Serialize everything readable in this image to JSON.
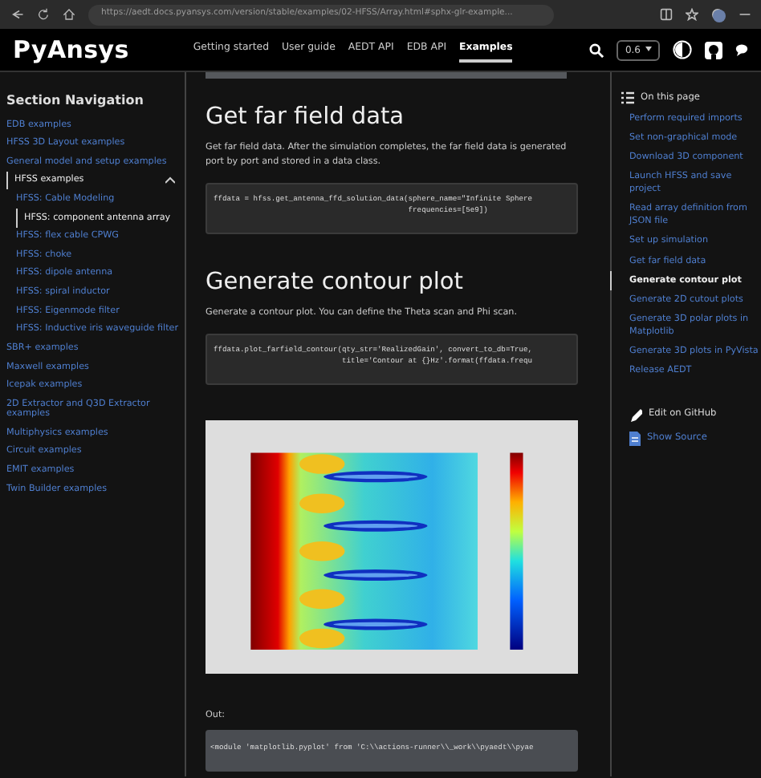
{
  "browser": {
    "url": "https://aedt.docs.pyansys.com/version/stable/examples/02-HFSS/Array.html#sphx-glr-example..."
  },
  "header": {
    "logo": "PyAnsys",
    "nav": [
      {
        "label": "Getting started",
        "selected": false
      },
      {
        "label": "User guide",
        "selected": false
      },
      {
        "label": "AEDT API",
        "selected": false
      },
      {
        "label": "EDB API",
        "selected": false
      },
      {
        "label": "Examples",
        "selected": true
      }
    ],
    "version": "0.6"
  },
  "sidebar": {
    "title": "Section Navigation",
    "items": [
      {
        "label": "EDB examples",
        "selected": false
      },
      {
        "label": "HFSS 3D Layout examples",
        "selected": false
      },
      {
        "label": "General model and setup examples",
        "selected": false
      },
      {
        "label": "HFSS examples",
        "selected": true,
        "expanded": true,
        "children": [
          {
            "label": "HFSS: Cable Modeling",
            "selected": false
          },
          {
            "label": "HFSS: component antenna array",
            "selected": true
          },
          {
            "label": "HFSS: flex cable CPWG",
            "selected": false
          },
          {
            "label": "HFSS: choke",
            "selected": false
          },
          {
            "label": "HFSS: dipole antenna",
            "selected": false
          },
          {
            "label": "HFSS: spiral inductor",
            "selected": false
          },
          {
            "label": "HFSS: Eigenmode filter",
            "selected": false
          },
          {
            "label": "HFSS: Inductive iris waveguide filter",
            "selected": false
          }
        ]
      },
      {
        "label": "SBR+ examples",
        "selected": false
      },
      {
        "label": "Maxwell examples",
        "selected": false
      },
      {
        "label": "Icepak examples",
        "selected": false
      },
      {
        "label": "2D Extractor and Q3D Extractor examples",
        "selected": false
      },
      {
        "label": "Multiphysics examples",
        "selected": false
      },
      {
        "label": "Circuit examples",
        "selected": false
      },
      {
        "label": "EMIT examples",
        "selected": false
      },
      {
        "label": "Twin Builder examples",
        "selected": false
      }
    ]
  },
  "content": [
    {
      "kind": "heading",
      "text": "Get far field data"
    },
    {
      "kind": "paragraph",
      "text": "Get far field data. After the simulation completes, the far field data is generated port by port and stored in a data class."
    },
    {
      "kind": "code",
      "lines": [
        "ffdata = hfss.get_antenna_ffd_solution_data(sphere_name=\"Infinite Sphere",
        "                                            frequencies=[5e9])"
      ]
    },
    {
      "kind": "heading",
      "text": "Generate contour plot"
    },
    {
      "kind": "paragraph",
      "text": "Generate a contour plot. You can define the Theta scan and Phi scan."
    },
    {
      "kind": "code",
      "lines": [
        "ffdata.plot_farfield_contour(qty_str='RealizedGain', convert_to_db=True,",
        "                             title='Contour at {}Hz'.format(ffdata.frequ"
      ]
    },
    {
      "kind": "plot"
    },
    {
      "kind": "label",
      "text": "Out:"
    },
    {
      "kind": "output",
      "lines": [
        "<module 'matplotlib.pyplot' from 'C:\\\\actions-runner\\\\_work\\\\pyaedt\\\\pyae"
      ]
    }
  ],
  "toc": {
    "title": "On this page",
    "items": [
      {
        "label": "Perform required imports",
        "selected": false
      },
      {
        "label": "Set non-graphical mode",
        "selected": false
      },
      {
        "label": "Download 3D component",
        "selected": false
      },
      {
        "label": "Launch HFSS and save project",
        "selected": false
      },
      {
        "label": "Read array definition from JSON file",
        "selected": false
      },
      {
        "label": "Set up simulation",
        "selected": false
      },
      {
        "label": "Get far field data",
        "selected": false
      },
      {
        "label": "Generate contour plot",
        "selected": true
      },
      {
        "label": "Generate 2D cutout plots",
        "selected": false
      },
      {
        "label": "Generate 3D polar plots in Matplotlib",
        "selected": false
      },
      {
        "label": "Generate 3D plots in PyVista",
        "selected": false
      },
      {
        "label": "Release AEDT",
        "selected": false
      }
    ],
    "actions": [
      {
        "kind": "edit",
        "label": "Edit on GitHub"
      },
      {
        "kind": "source",
        "label": "Show Source"
      }
    ]
  }
}
